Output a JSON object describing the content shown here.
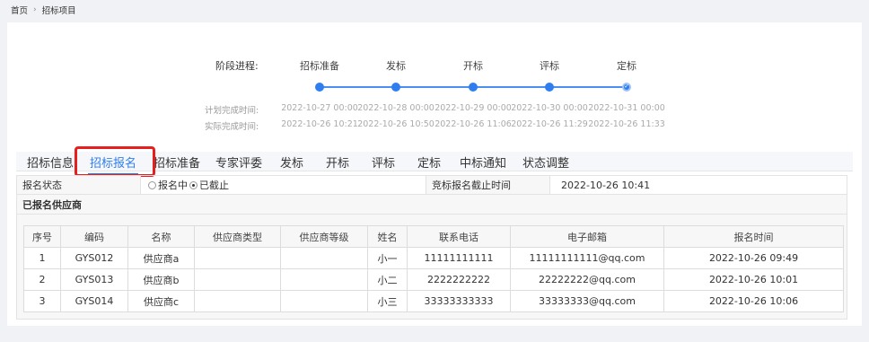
{
  "breadcrumb": {
    "home": "首页",
    "separator": "›",
    "current": "招标项目"
  },
  "progress": {
    "title": "阶段进程:",
    "plan_label": "计划完成时间:",
    "actual_label": "实际完成时间:",
    "stages": [
      {
        "name": "招标准备",
        "plan": "2022-10-27 00:00",
        "actual": "2022-10-26 10:21"
      },
      {
        "name": "发标",
        "plan": "2022-10-28 00:00",
        "actual": "2022-10-26 10:50"
      },
      {
        "name": "开标",
        "plan": "2022-10-29 00:00",
        "actual": "2022-10-26 11:06"
      },
      {
        "name": "评标",
        "plan": "2022-10-30 00:00",
        "actual": "2022-10-26 11:29"
      },
      {
        "name": "定标",
        "plan": "2022-10-31 00:00",
        "actual": "2022-10-26 11:33"
      }
    ]
  },
  "tabs": [
    "招标信息",
    "招标报名",
    "招标准备",
    "专家评委",
    "发标",
    "开标",
    "评标",
    "定标",
    "中标通知",
    "状态调整"
  ],
  "active_tab": "招标报名",
  "registration": {
    "status_label": "报名状态",
    "options": [
      "报名中",
      "已截止"
    ],
    "selected": "已截止",
    "deadline_label": "竞标报名截止时间",
    "deadline_value": "2022-10-26 10:41"
  },
  "suppliers_section": "已报名供应商",
  "table": {
    "headers": [
      "序号",
      "编码",
      "名称",
      "供应商类型",
      "供应商等级",
      "姓名",
      "联系电话",
      "电子邮箱",
      "报名时间"
    ],
    "rows": [
      [
        "1",
        "GYS012",
        "供应商a",
        "",
        "",
        "小一",
        "11111111111",
        "11111111111@qq.com",
        "2022-10-26 09:49"
      ],
      [
        "2",
        "GYS013",
        "供应商b",
        "",
        "",
        "小二",
        "2222222222",
        "22222222@qq.com",
        "2022-10-26 10:01"
      ],
      [
        "3",
        "GYS014",
        "供应商c",
        "",
        "",
        "小三",
        "33333333333",
        "33333333@qq.com",
        "2022-10-26 10:06"
      ]
    ]
  },
  "colors": {
    "accent": "#2f7ef0",
    "highlight": "#e61e1e"
  }
}
